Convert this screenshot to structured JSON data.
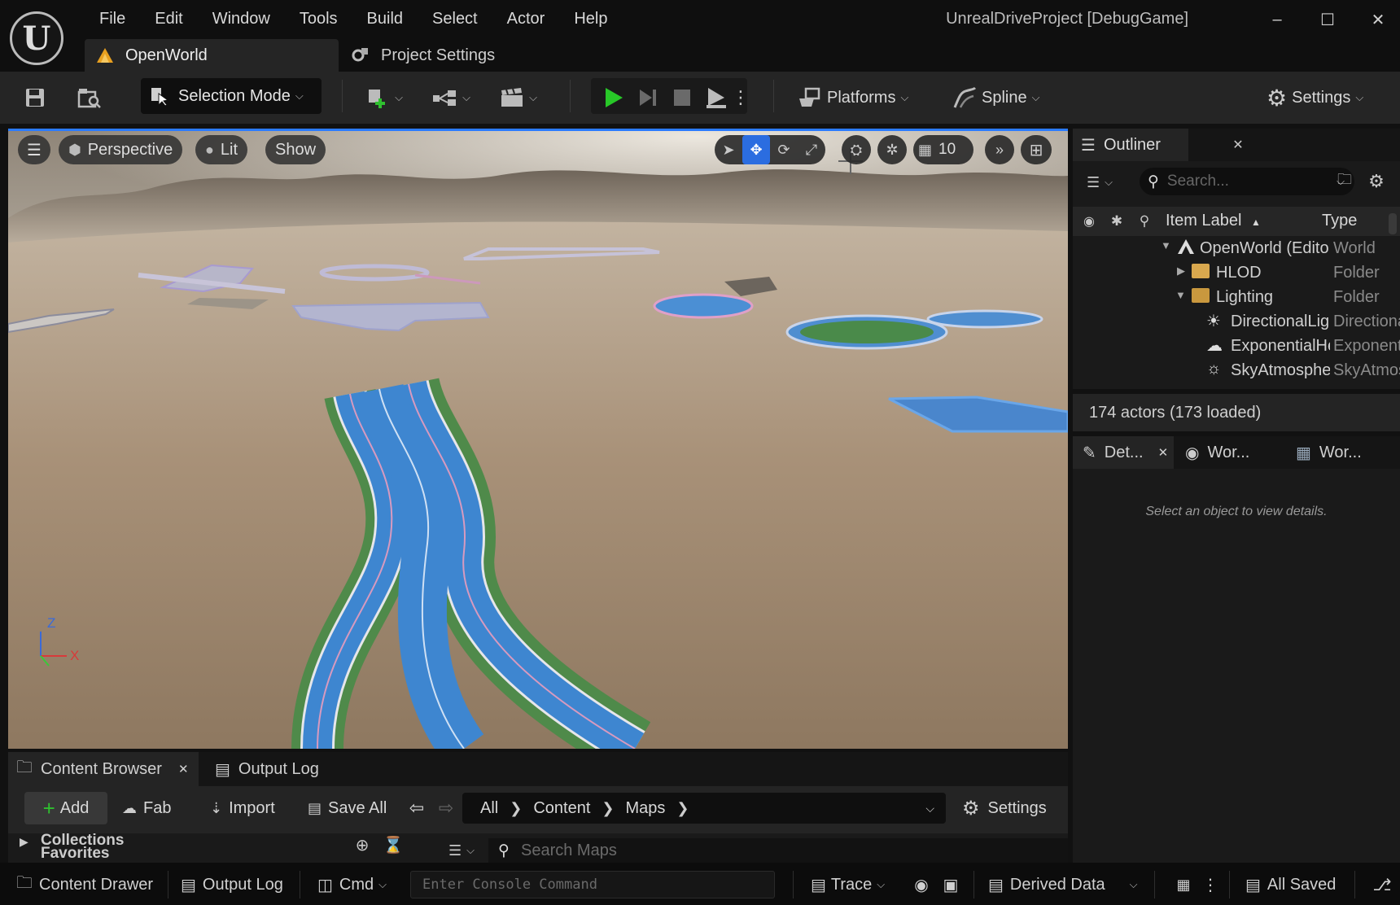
{
  "app": {
    "logo": "U",
    "menu": [
      "File",
      "Edit",
      "Window",
      "Tools",
      "Build",
      "Select",
      "Actor",
      "Help"
    ],
    "document_tab": "OpenWorld",
    "project_settings_tab": "Project Settings",
    "window_title": "UnrealDriveProject [DebugGame]",
    "window_controls": {
      "minimize": "–",
      "maximize": "☐",
      "close": "✕"
    }
  },
  "toolbar": {
    "selection_mode": "Selection Mode",
    "platforms": "Platforms",
    "spline": "Spline",
    "settings": "Settings",
    "play_color": "#28c828"
  },
  "viewport": {
    "perspective": "Perspective",
    "lit": "Lit",
    "show": "Show",
    "grid_snap": "10",
    "axis": {
      "z": "Z",
      "x": "X"
    },
    "accent": "#2b7bff"
  },
  "outliner": {
    "tab": "Outliner",
    "search_placeholder": "Search...",
    "col_label": "Item Label",
    "col_type": "Type",
    "items": [
      {
        "label": "OpenWorld (Editor)",
        "type": "World"
      },
      {
        "label": "HLOD",
        "type": "Folder"
      },
      {
        "label": "Lighting",
        "type": "Folder"
      },
      {
        "label": "DirectionalLight",
        "type": "DirectionalLight"
      },
      {
        "label": "ExponentialHeightFog",
        "type": "ExponentialHeightFog"
      },
      {
        "label": "SkyAtmosphere",
        "type": "SkyAtmosphere"
      }
    ],
    "status": "174 actors (173 loaded)"
  },
  "details": {
    "tabs": [
      "Det...",
      "Wor...",
      "Wor..."
    ],
    "empty_message": "Select an object to view details."
  },
  "content_browser": {
    "tab": "Content Browser",
    "output_log_tab": "Output Log",
    "add": "Add",
    "fab": "Fab",
    "import": "Import",
    "save_all": "Save All",
    "path": [
      "All",
      "Content",
      "Maps"
    ],
    "settings": "Settings",
    "collections": "Collections",
    "favorites": "Favorites",
    "search_placeholder": "Search Maps"
  },
  "statusbar": {
    "content_drawer": "Content Drawer",
    "output_log": "Output Log",
    "cmd": "Cmd",
    "console_placeholder": "Enter Console Command",
    "trace": "Trace",
    "derived_data": "Derived Data",
    "all_saved": "All Saved"
  }
}
